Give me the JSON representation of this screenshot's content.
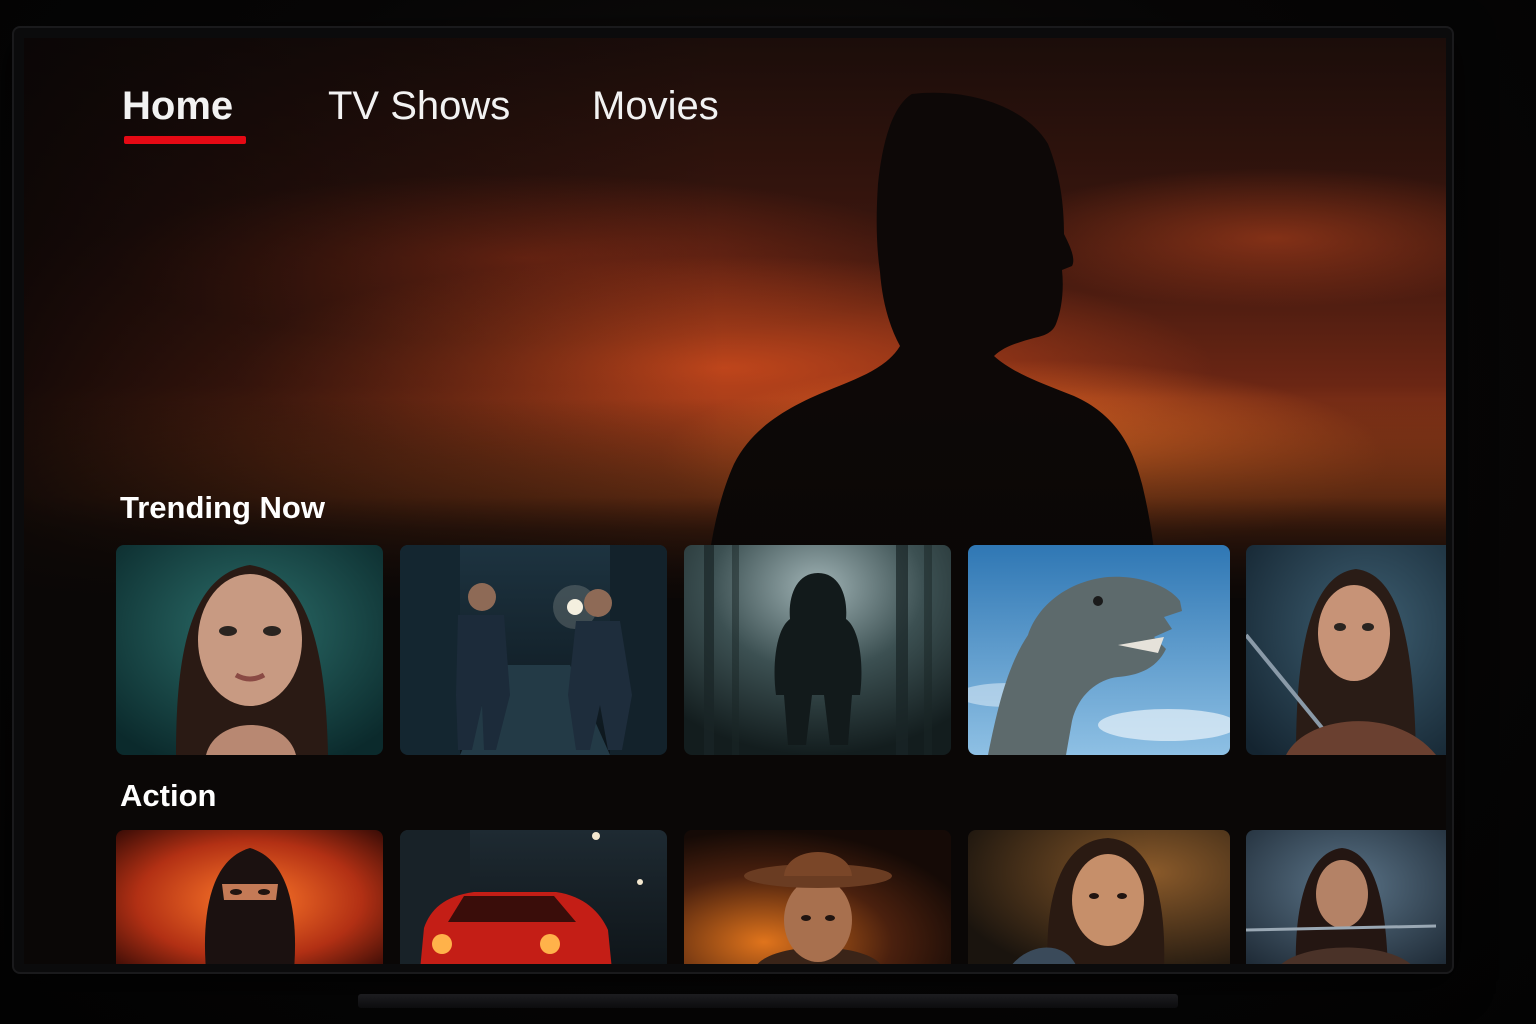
{
  "nav": {
    "items": [
      {
        "label": "Home",
        "active": true
      },
      {
        "label": "TV Shows",
        "active": false
      },
      {
        "label": "Movies",
        "active": false
      }
    ],
    "active_color": "#e50914"
  },
  "rows": [
    {
      "title": "Trending Now",
      "tiles": [
        {
          "icon": "woman-portrait-teal"
        },
        {
          "icon": "two-men-running-alley"
        },
        {
          "icon": "hooded-figure-forest"
        },
        {
          "icon": "dinosaur-sky"
        },
        {
          "icon": "archer-woman"
        }
      ]
    },
    {
      "title": "Action",
      "tiles": [
        {
          "icon": "masked-figure-fire"
        },
        {
          "icon": "red-car-night"
        },
        {
          "icon": "man-fedora-fire"
        },
        {
          "icon": "woman-portrait-warm"
        },
        {
          "icon": "woman-fighter-smoke"
        }
      ]
    }
  ]
}
